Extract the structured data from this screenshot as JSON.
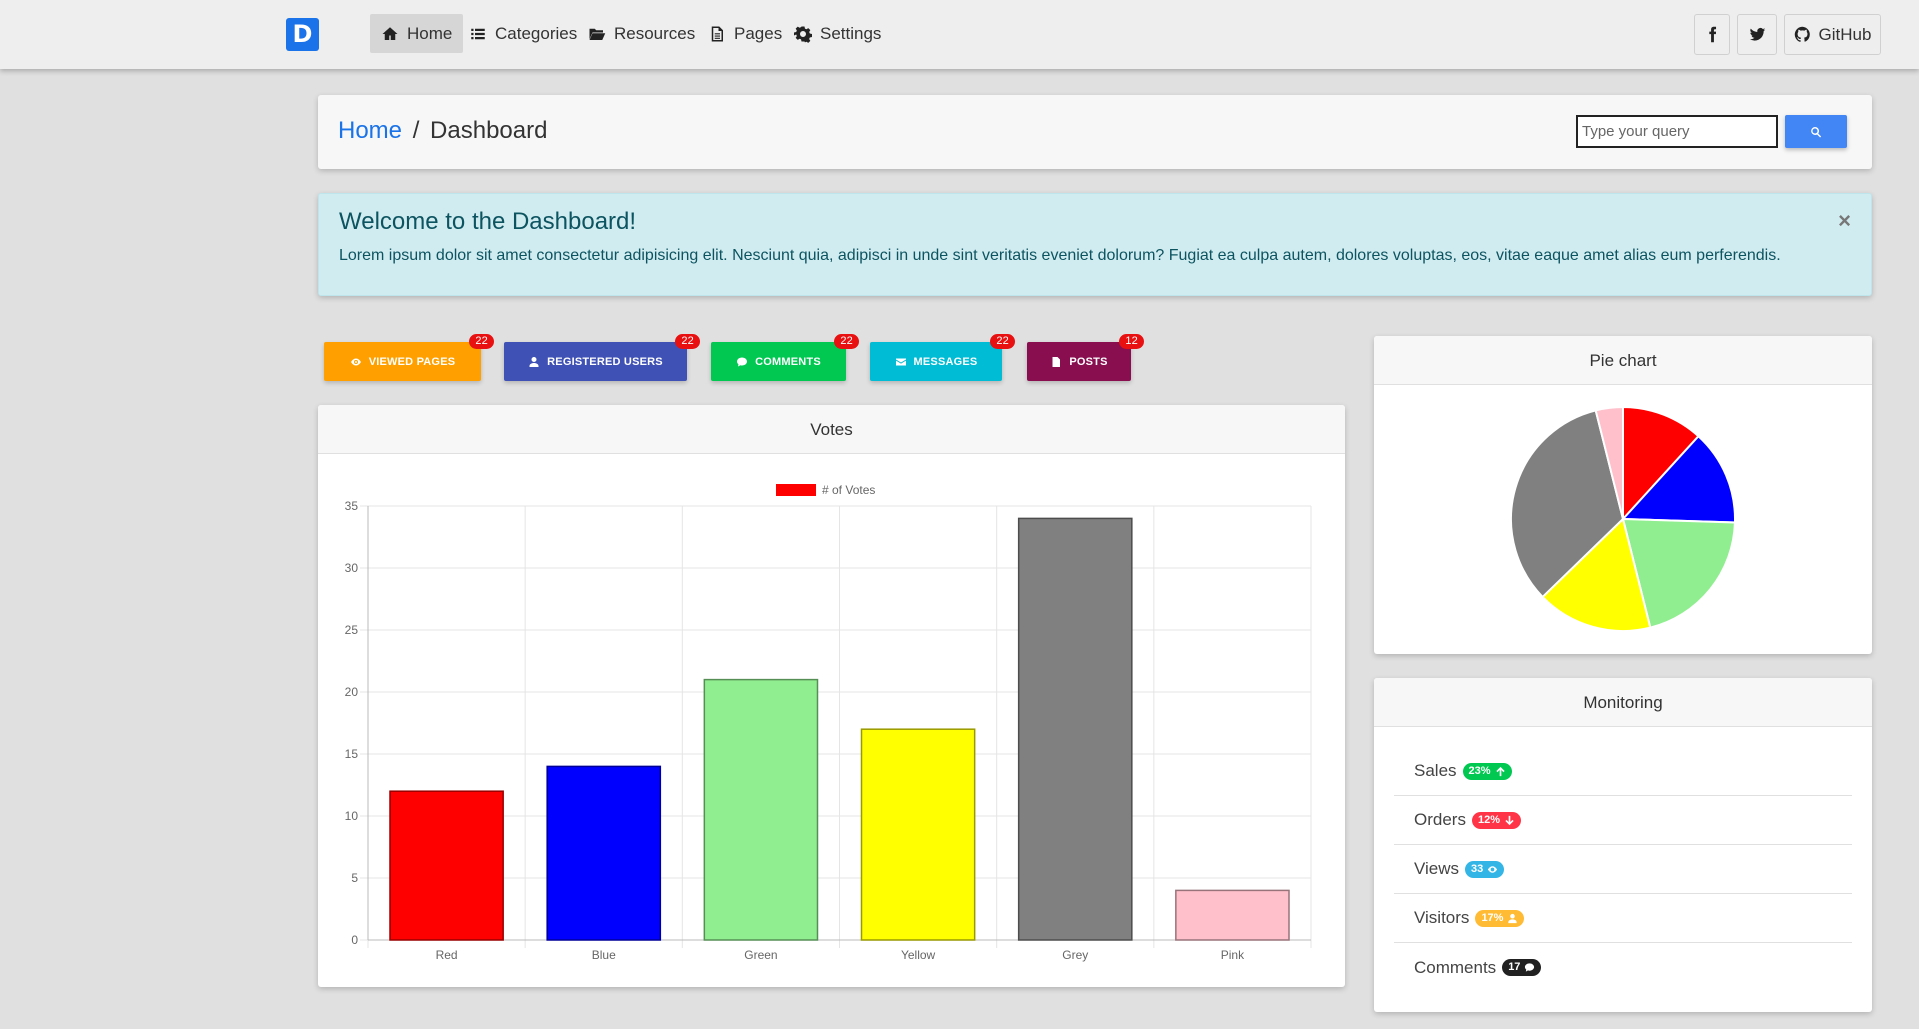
{
  "navbar": {
    "brand": "D",
    "items": [
      {
        "label": "Home",
        "icon": "home-icon",
        "active": true
      },
      {
        "label": "Categories",
        "icon": "list-icon",
        "active": false
      },
      {
        "label": "Resources",
        "icon": "folder-open-icon",
        "active": false
      },
      {
        "label": "Pages",
        "icon": "file-icon",
        "active": false
      },
      {
        "label": "Settings",
        "icon": "gear-icon",
        "active": false
      }
    ],
    "social": {
      "facebook": "facebook-icon",
      "twitter": "twitter-icon",
      "github_label": "GitHub"
    }
  },
  "breadcrumb": {
    "home": "Home",
    "separator": "/",
    "current": "Dashboard"
  },
  "search": {
    "placeholder": "Type your query"
  },
  "alert": {
    "title": "Welcome to the Dashboard!",
    "text": "Lorem ipsum dolor sit amet consectetur adipisicing elit. Nesciunt quia, adipisci in unde sint veritatis eveniet dolorum? Fugiat ea culpa autem, dolores voluptas, eos, vitae eaque amet alias eum perferendis.",
    "close": "×"
  },
  "stat_buttons": [
    {
      "label": "Viewed pages",
      "count": "22",
      "color": "#ffa000",
      "icon": "eye-icon"
    },
    {
      "label": "Registered users",
      "count": "22",
      "color": "#3f51b5",
      "icon": "user-icon"
    },
    {
      "label": "Comments",
      "count": "22",
      "color": "#00c851",
      "icon": "comment-icon"
    },
    {
      "label": "Messages",
      "count": "22",
      "color": "#00bcd4",
      "icon": "envelope-icon"
    },
    {
      "label": "Posts",
      "count": "12",
      "color": "#880e4f",
      "icon": "file-icon"
    }
  ],
  "votes_card": {
    "title": "Votes"
  },
  "pie_card": {
    "title": "Pie chart"
  },
  "monitoring": {
    "title": "Monitoring",
    "items": [
      {
        "label": "Sales",
        "value": "23%",
        "color": "#00c851",
        "icon": "arrow-up-icon"
      },
      {
        "label": "Orders",
        "value": "12%",
        "color": "#ff3547",
        "icon": "arrow-down-icon"
      },
      {
        "label": "Views",
        "value": "33",
        "color": "#33b5e5",
        "icon": "eye-icon"
      },
      {
        "label": "Visitors",
        "value": "17%",
        "color": "#ffbb33",
        "icon": "user-icon"
      },
      {
        "label": "Comments",
        "value": "17",
        "color": "#212121",
        "icon": "comment-icon"
      }
    ]
  },
  "chart_data": [
    {
      "type": "bar",
      "categories": [
        "Red",
        "Blue",
        "Green",
        "Yellow",
        "Grey",
        "Pink"
      ],
      "series": [
        {
          "name": "# of Votes",
          "values": [
            12,
            14,
            21,
            17,
            34,
            4
          ]
        }
      ],
      "colors": [
        "#ff0000",
        "#0000ff",
        "#90ee90",
        "#ffff00",
        "#808080",
        "#ffc0cb"
      ],
      "legend_color": "#ff0000",
      "ylim": [
        0,
        35
      ],
      "yticks": [
        0,
        5,
        10,
        15,
        20,
        25,
        30,
        35
      ],
      "grid": true,
      "legend": "top"
    },
    {
      "type": "pie",
      "categories": [
        "Red",
        "Blue",
        "Green",
        "Yellow",
        "Grey",
        "Pink"
      ],
      "values": [
        12,
        14,
        21,
        17,
        34,
        4
      ],
      "colors": [
        "#ff0000",
        "#0000ff",
        "#90ee90",
        "#ffff00",
        "#808080",
        "#ffc0cb"
      ]
    }
  ]
}
